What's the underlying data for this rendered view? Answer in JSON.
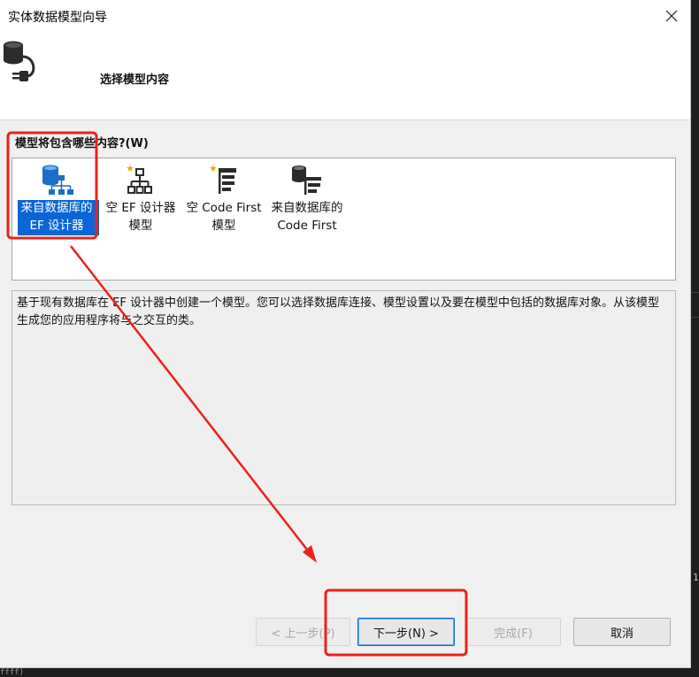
{
  "dialog": {
    "title": "实体数据模型向导",
    "header_title": "选择模型内容"
  },
  "options_section": {
    "question": "模型将包含哪些内容?(W)",
    "options": [
      {
        "line1": "来自数据库的",
        "line2": "EF 设计器",
        "icon": "database-diagram-icon",
        "selected": true
      },
      {
        "line1": "空 EF 设计器",
        "line2": "模型",
        "icon": "empty-diagram-icon",
        "selected": false
      },
      {
        "line1": "空 Code First",
        "line2": "模型",
        "icon": "code-first-icon",
        "selected": false
      },
      {
        "line1": "来自数据库的",
        "line2": "Code First",
        "icon": "database-code-first-icon",
        "selected": false
      }
    ],
    "description": "基于现有数据库在 EF 设计器中创建一个模型。您可以选择数据库连接、模型设置以及要在模型中包括的数据库对象。从该模型生成您的应用程序将与之交互的类。"
  },
  "buttons": {
    "previous": "< 上一步(P)",
    "next": "下一步(N) >",
    "finish": "完成(F)",
    "cancel": "取消"
  },
  "background_editor": {
    "digit": "1",
    "tail_text": "ffff)"
  },
  "annotation_color": "#e8231b"
}
